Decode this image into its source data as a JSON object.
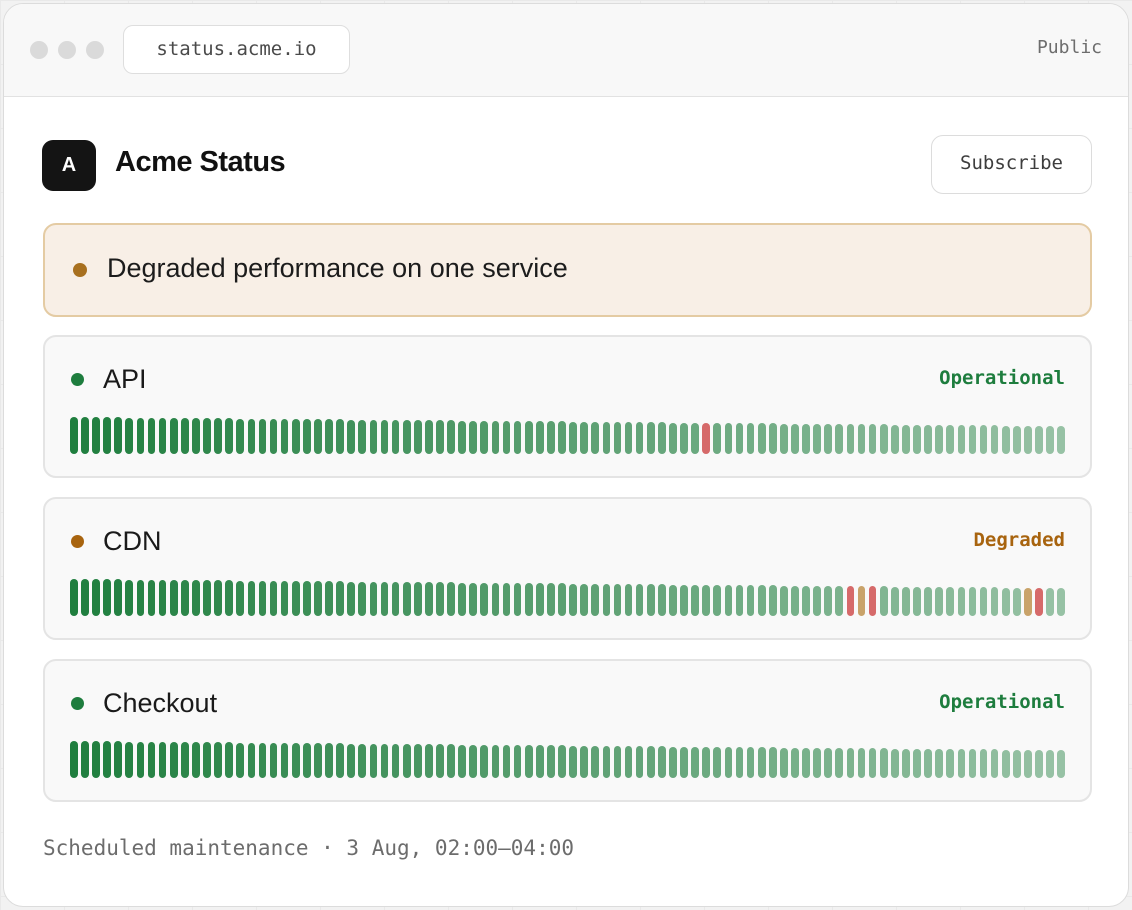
{
  "browser": {
    "url": "status.acme.io",
    "visibility": "Public"
  },
  "header": {
    "logo_letter": "A",
    "title": "Acme Status",
    "subscribe_label": "Subscribe"
  },
  "banner": {
    "text": "Degraded performance on one service",
    "color": "#a8701f"
  },
  "colors": {
    "operational": "#1e7d3e",
    "degraded": "#a8640f",
    "bar_ok": "#1f7e3e",
    "bar_outage": "#d66a6a",
    "bar_degraded": "#c9a36a"
  },
  "services": [
    {
      "name": "API",
      "status": "Operational",
      "status_key": "operational",
      "uptime_bars": [
        "ok",
        "ok",
        "ok",
        "ok",
        "ok",
        "ok",
        "ok",
        "ok",
        "ok",
        "ok",
        "ok",
        "ok",
        "ok",
        "ok",
        "ok",
        "ok",
        "ok",
        "ok",
        "ok",
        "ok",
        "ok",
        "ok",
        "ok",
        "ok",
        "ok",
        "ok",
        "ok",
        "ok",
        "ok",
        "ok",
        "ok",
        "ok",
        "ok",
        "ok",
        "ok",
        "ok",
        "ok",
        "ok",
        "ok",
        "ok",
        "ok",
        "ok",
        "ok",
        "ok",
        "ok",
        "ok",
        "ok",
        "ok",
        "ok",
        "ok",
        "ok",
        "ok",
        "ok",
        "ok",
        "ok",
        "ok",
        "ok",
        "outage",
        "ok",
        "ok",
        "ok",
        "ok",
        "ok",
        "ok",
        "ok",
        "ok",
        "ok",
        "ok",
        "ok",
        "ok",
        "ok",
        "ok",
        "ok",
        "ok",
        "ok",
        "ok",
        "ok",
        "ok",
        "ok",
        "ok",
        "ok",
        "ok",
        "ok",
        "ok",
        "ok",
        "ok",
        "ok",
        "ok",
        "ok",
        "ok"
      ]
    },
    {
      "name": "CDN",
      "status": "Degraded",
      "status_key": "degraded",
      "uptime_bars": [
        "ok",
        "ok",
        "ok",
        "ok",
        "ok",
        "ok",
        "ok",
        "ok",
        "ok",
        "ok",
        "ok",
        "ok",
        "ok",
        "ok",
        "ok",
        "ok",
        "ok",
        "ok",
        "ok",
        "ok",
        "ok",
        "ok",
        "ok",
        "ok",
        "ok",
        "ok",
        "ok",
        "ok",
        "ok",
        "ok",
        "ok",
        "ok",
        "ok",
        "ok",
        "ok",
        "ok",
        "ok",
        "ok",
        "ok",
        "ok",
        "ok",
        "ok",
        "ok",
        "ok",
        "ok",
        "ok",
        "ok",
        "ok",
        "ok",
        "ok",
        "ok",
        "ok",
        "ok",
        "ok",
        "ok",
        "ok",
        "ok",
        "ok",
        "ok",
        "ok",
        "ok",
        "ok",
        "ok",
        "ok",
        "ok",
        "ok",
        "ok",
        "ok",
        "ok",
        "ok",
        "outage",
        "degraded",
        "outage",
        "ok",
        "ok",
        "ok",
        "ok",
        "ok",
        "ok",
        "ok",
        "ok",
        "ok",
        "ok",
        "ok",
        "ok",
        "ok",
        "degraded",
        "outage",
        "ok",
        "ok"
      ]
    },
    {
      "name": "Checkout",
      "status": "Operational",
      "status_key": "operational",
      "uptime_bars": [
        "ok",
        "ok",
        "ok",
        "ok",
        "ok",
        "ok",
        "ok",
        "ok",
        "ok",
        "ok",
        "ok",
        "ok",
        "ok",
        "ok",
        "ok",
        "ok",
        "ok",
        "ok",
        "ok",
        "ok",
        "ok",
        "ok",
        "ok",
        "ok",
        "ok",
        "ok",
        "ok",
        "ok",
        "ok",
        "ok",
        "ok",
        "ok",
        "ok",
        "ok",
        "ok",
        "ok",
        "ok",
        "ok",
        "ok",
        "ok",
        "ok",
        "ok",
        "ok",
        "ok",
        "ok",
        "ok",
        "ok",
        "ok",
        "ok",
        "ok",
        "ok",
        "ok",
        "ok",
        "ok",
        "ok",
        "ok",
        "ok",
        "ok",
        "ok",
        "ok",
        "ok",
        "ok",
        "ok",
        "ok",
        "ok",
        "ok",
        "ok",
        "ok",
        "ok",
        "ok",
        "ok",
        "ok",
        "ok",
        "ok",
        "ok",
        "ok",
        "ok",
        "ok",
        "ok",
        "ok",
        "ok",
        "ok",
        "ok",
        "ok",
        "ok",
        "ok",
        "ok",
        "ok",
        "ok",
        "ok"
      ]
    }
  ],
  "footer": {
    "text": "Scheduled maintenance · 3 Aug, 02:00–04:00"
  }
}
